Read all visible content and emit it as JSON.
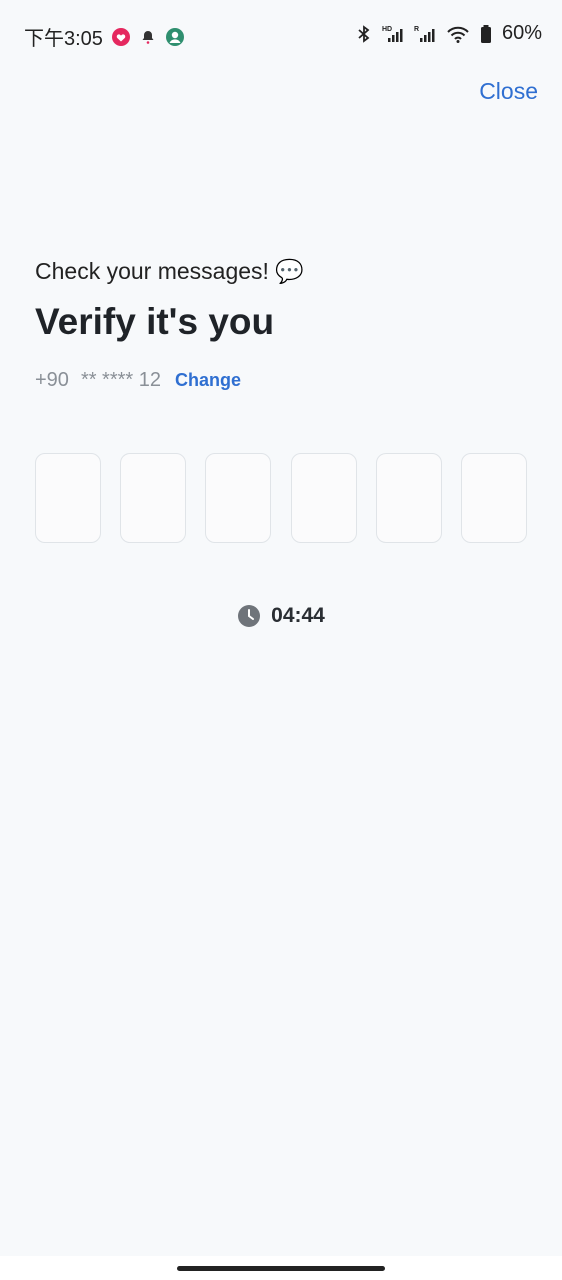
{
  "status_bar": {
    "time": "下午3:05",
    "battery_percent": "60%",
    "network_hd": "HD",
    "network_r": "R",
    "icons": [
      "heart-notification-icon",
      "bell-icon",
      "avatar-icon",
      "bluetooth-icon",
      "signal-hd-icon",
      "signal-r-icon",
      "wifi-icon",
      "battery-icon"
    ]
  },
  "header": {
    "close_label": "Close"
  },
  "content": {
    "kicker": "Check your messages! 💬",
    "title": "Verify it's you",
    "phone_prefix": "+90",
    "phone_masked": "** **** 12",
    "change_label": "Change"
  },
  "otp": {
    "length": 6,
    "values": [
      "",
      "",
      "",
      "",
      "",
      ""
    ]
  },
  "timer": {
    "value": "04:44"
  },
  "colors": {
    "accent": "#2f6fd1",
    "background": "#f7f9fb",
    "text": "#1f2328",
    "muted": "#8a9097"
  }
}
